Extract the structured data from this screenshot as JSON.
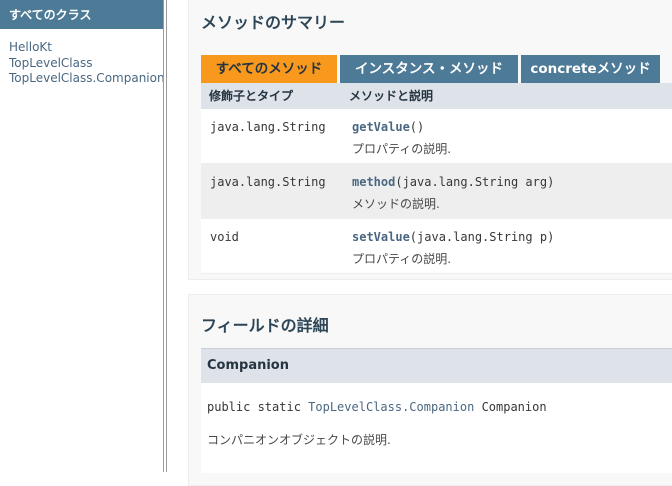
{
  "sidebar": {
    "header": "すべてのクラス",
    "classes": [
      "HelloKt",
      "TopLevelClass",
      "TopLevelClass.Companion"
    ]
  },
  "method_summary": {
    "title": "メソッドのサマリー",
    "tabs": [
      "すべてのメソッド",
      "インスタンス・メソッド",
      "concreteメソッド"
    ],
    "columns": [
      "修飾子とタイプ",
      "メソッドと説明"
    ],
    "rows": [
      {
        "type": "java.lang.String",
        "name": "getValue",
        "params": "()",
        "description": "プロパティの説明."
      },
      {
        "type": "java.lang.String",
        "name": "method",
        "params": "(java.lang.String arg)",
        "description": "メソッドの説明."
      },
      {
        "type": "void",
        "name": "setValue",
        "params": "(java.lang.String p)",
        "description": "プロパティの説明."
      }
    ]
  },
  "field_details": {
    "title": "フィールドの詳細",
    "field_name": "Companion",
    "signature_prefix": "public static",
    "signature_type": "TopLevelClass.Companion",
    "signature_name": "Companion",
    "description": "コンパニオンオブジェクトの説明."
  },
  "colors": {
    "header_blue": "#4D7A97",
    "active_tab": "#F8981D",
    "link": "#4A6782",
    "table_header": "#DEE3E9"
  }
}
